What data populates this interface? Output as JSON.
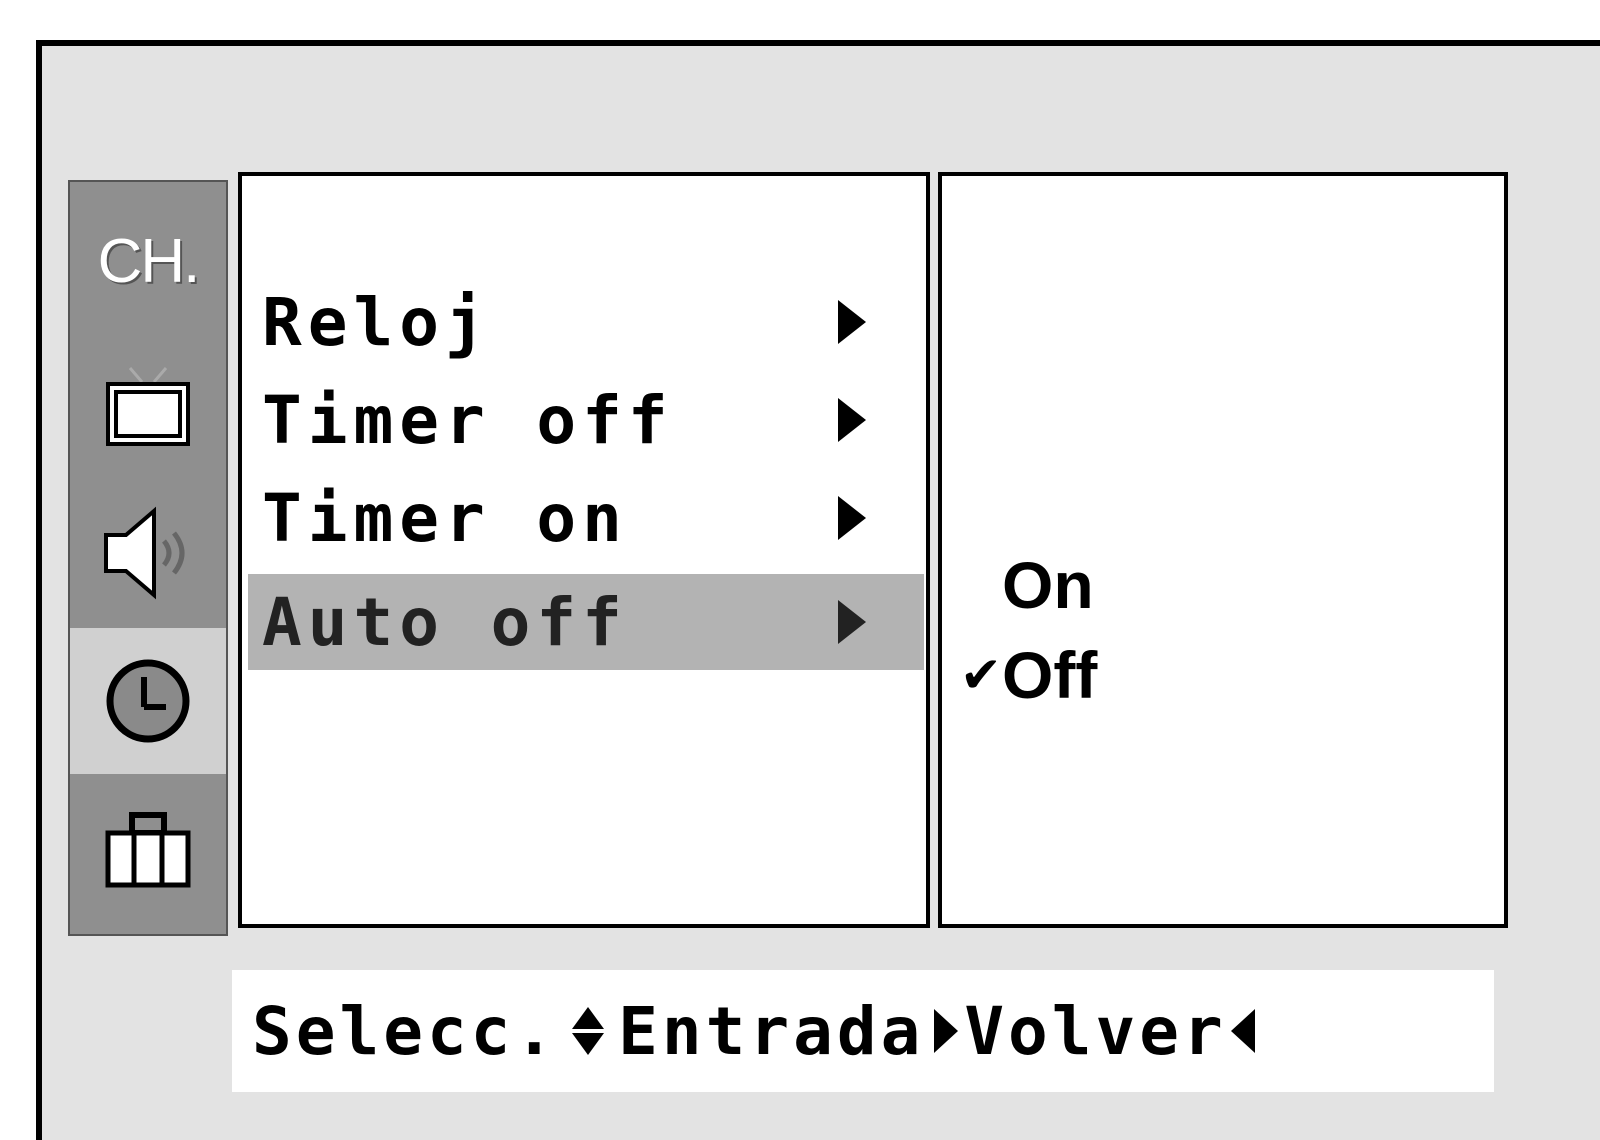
{
  "sidebar": {
    "ch_label": "CH.",
    "icons": [
      "picture-icon",
      "audio-icon",
      "clock-icon",
      "toolbox-icon"
    ],
    "active": "clock-icon"
  },
  "menu": {
    "items": [
      {
        "label": "Reloj"
      },
      {
        "label": "Timer off"
      },
      {
        "label": "Timer on"
      },
      {
        "label": "Auto off",
        "selected": true
      }
    ]
  },
  "submenu": {
    "options": [
      {
        "label": "On"
      },
      {
        "label": "Off",
        "checked": true
      }
    ]
  },
  "help": {
    "select": "Selecc.",
    "enter": "Entrada",
    "back": "Volver"
  }
}
